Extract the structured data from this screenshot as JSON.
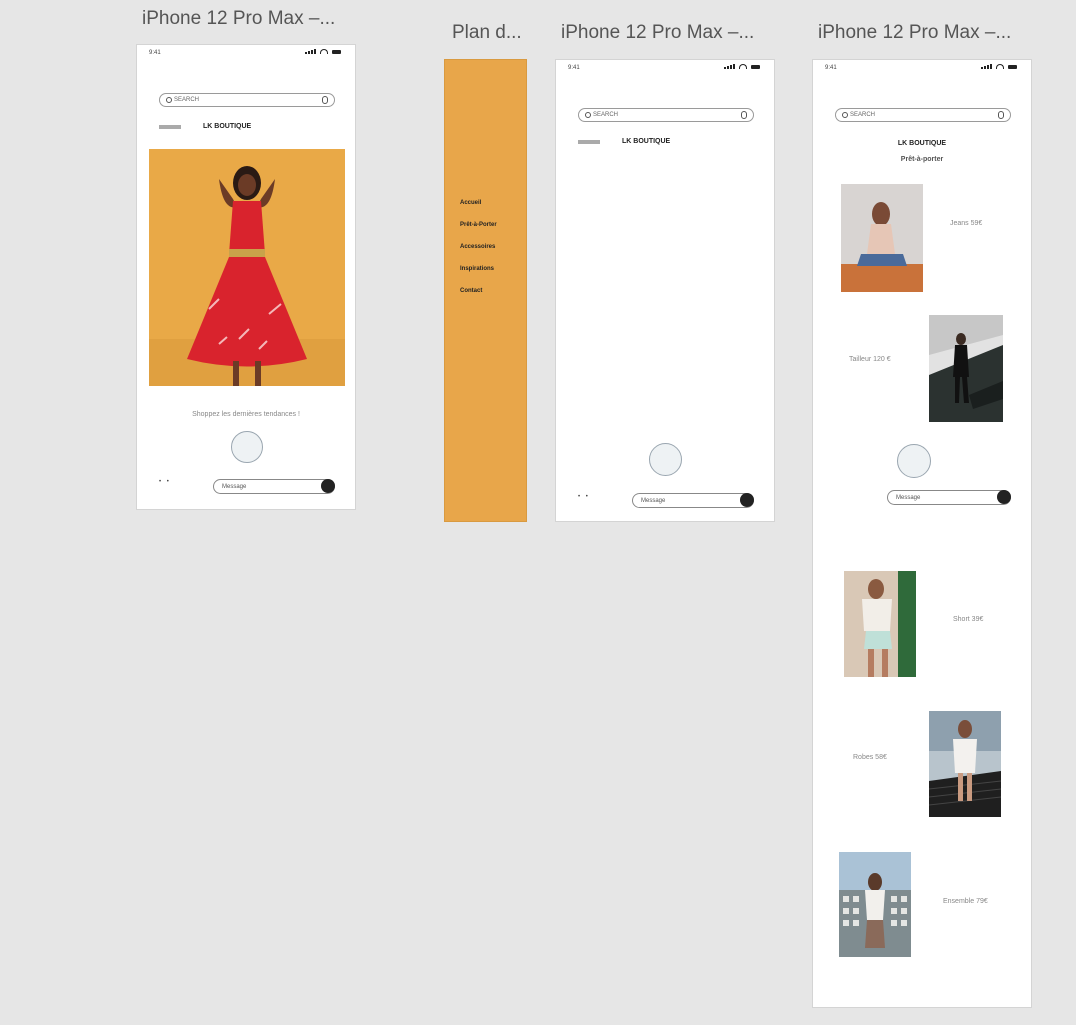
{
  "artboards": {
    "home": {
      "title": "iPhone 12 Pro Max –...",
      "time": "9:41",
      "search_placeholder": "SEARCH",
      "brand": "LK BOUTIQUE",
      "tagline": "Shoppez les dernières tendances !",
      "message_placeholder": "Message",
      "hero_icon": "red-dress-model-photo"
    },
    "menu": {
      "title": "Plan d...",
      "bg_color": "#e8a64a",
      "items": [
        "Accueil",
        "Prêt-à-Porter",
        "Accessoires",
        "Inspirations",
        "Contact"
      ]
    },
    "blank": {
      "title": "iPhone 12 Pro Max –...",
      "time": "9:41",
      "search_placeholder": "SEARCH",
      "brand": "LK BOUTIQUE",
      "message_placeholder": "Message"
    },
    "catalog": {
      "title": "iPhone 12 Pro Max –...",
      "time": "9:41",
      "search_placeholder": "SEARCH",
      "brand": "LK BOUTIQUE",
      "subtitle": "Prêt-à-porter",
      "message_placeholder": "Message",
      "products": [
        {
          "label": "Jeans 59€",
          "icon": "seated-model-photo"
        },
        {
          "label": "Tailleur 120 €",
          "icon": "suit-model-photo"
        },
        {
          "label": "Short 39€",
          "icon": "white-top-model-photo"
        },
        {
          "label": "Robes 58€",
          "icon": "white-dress-model-photo"
        },
        {
          "label": "Ensemble 79€",
          "icon": "building-model-photo"
        }
      ]
    }
  },
  "colors": {
    "hero_bg": "#e9a947",
    "dress_red": "#d9232d",
    "menu_orange": "#e8a64a"
  }
}
